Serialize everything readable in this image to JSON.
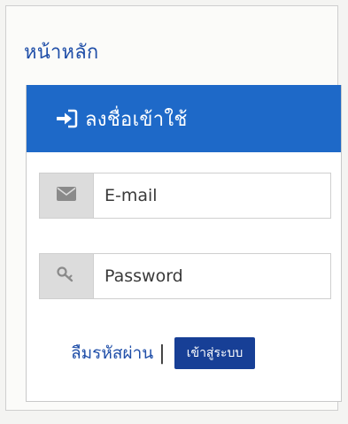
{
  "home": {
    "title": "หน้าหลัก"
  },
  "login": {
    "header_icon": "sign-in-icon",
    "header_title": "ลงชื่อเข้าใช้",
    "email": {
      "icon": "envelope-icon",
      "placeholder": "E-mail",
      "value": ""
    },
    "password": {
      "icon": "key-icon",
      "placeholder": "Password",
      "value": ""
    },
    "forgot_label": "ลืมรหัสผ่าน",
    "separator": "|",
    "submit_label": "เข้าสู่ระบบ"
  },
  "colors": {
    "header_bg": "#1e69c8",
    "link": "#1f4ea8",
    "button_bg": "#173f96",
    "addon_bg": "#dcdcdc"
  }
}
